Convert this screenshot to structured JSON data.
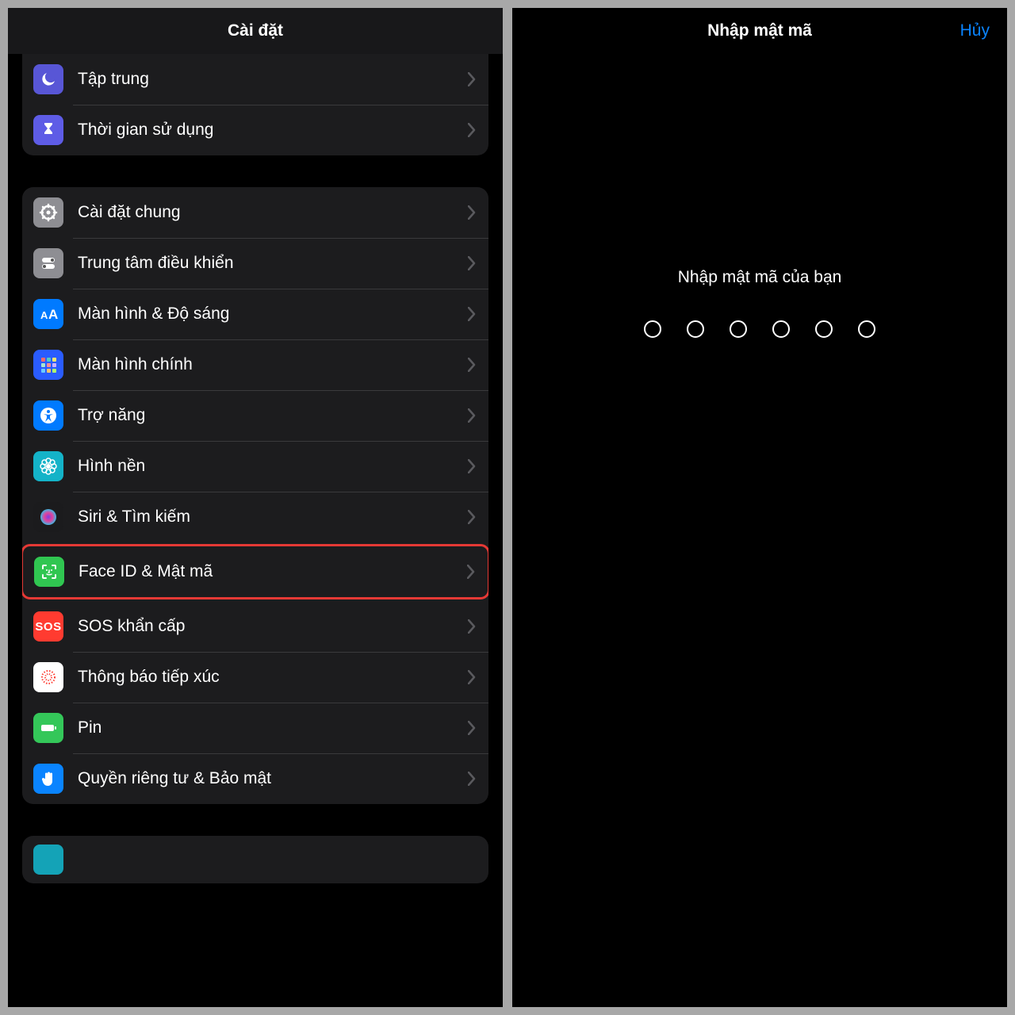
{
  "left": {
    "title": "Cài đặt",
    "group1": [
      {
        "key": "focus",
        "icon": "moon-icon",
        "color": "ic-purple",
        "label": "Tập trung"
      },
      {
        "key": "screentime",
        "icon": "hourglass-icon",
        "color": "ic-violet",
        "label": "Thời gian sử dụng"
      }
    ],
    "group2": [
      {
        "key": "general",
        "icon": "gear-icon",
        "color": "ic-gray",
        "label": "Cài đặt chung"
      },
      {
        "key": "control",
        "icon": "switches-icon",
        "color": "ic-lightgray",
        "label": "Trung tâm điều khiển"
      },
      {
        "key": "display",
        "icon": "textsize-icon",
        "color": "ic-blue",
        "label": "Màn hình & Độ sáng"
      },
      {
        "key": "home",
        "icon": "apps-icon",
        "color": "ic-home",
        "label": "Màn hình chính"
      },
      {
        "key": "access",
        "icon": "accessibility-icon",
        "color": "ic-blue",
        "label": "Trợ năng"
      },
      {
        "key": "wallpaper",
        "icon": "flower-icon",
        "color": "ic-cyan",
        "label": "Hình nền"
      },
      {
        "key": "siri",
        "icon": "siri-icon",
        "color": "ic-black",
        "label": "Siri & Tìm kiếm"
      },
      {
        "key": "faceid",
        "icon": "faceid-icon",
        "color": "ic-green",
        "label": "Face ID & Mật mã",
        "highlight": true
      },
      {
        "key": "sos",
        "icon": "sos-icon",
        "color": "ic-red",
        "label": "SOS khẩn cấp"
      },
      {
        "key": "exposure",
        "icon": "exposure-icon",
        "color": "ic-white",
        "label": "Thông báo tiếp xúc"
      },
      {
        "key": "battery",
        "icon": "battery-icon",
        "color": "ic-battery",
        "label": "Pin"
      },
      {
        "key": "privacy",
        "icon": "hand-icon",
        "color": "ic-hand",
        "label": "Quyền riêng tư & Bảo mật"
      }
    ]
  },
  "right": {
    "title": "Nhập mật mã",
    "cancel": "Hủy",
    "prompt": "Nhập mật mã của bạn",
    "dot_count": 6
  }
}
